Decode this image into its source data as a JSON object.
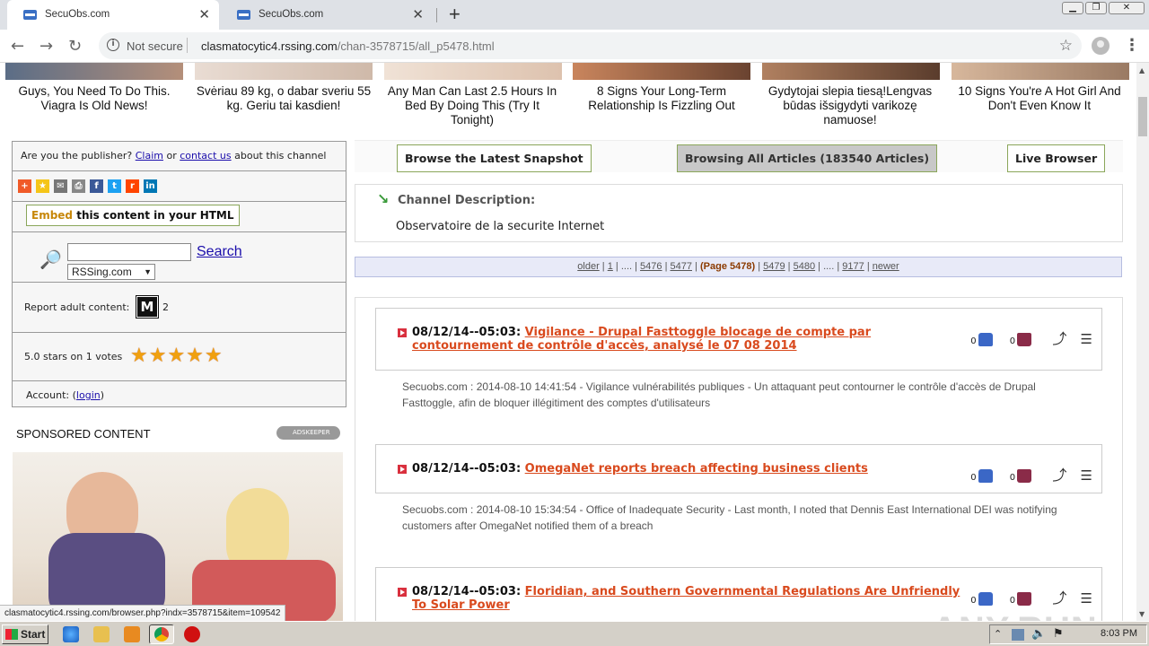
{
  "browser": {
    "tabs": [
      {
        "title": "SecuObs.com",
        "active": true
      },
      {
        "title": "SecuObs.com",
        "active": false
      }
    ],
    "not_secure": "Not secure",
    "url_host": "clasmatocytic4.rssing.com",
    "url_path": "/chan-3578715/all_p5478.html"
  },
  "ads": [
    "Guys, You Need To Do This. Viagra Is Old News!",
    "Svėriau 89 kg, o dabar sveriu 55 kg. Geriu tai kasdien!",
    "Any Man Can Last 2.5 Hours In Bed By Doing This (Try It Tonight)",
    "8 Signs Your Long-Term Relationship Is Fizzling Out",
    "Gydytojai slepia tiesą!Lengvas būdas išsigydyti varikozę namuose!",
    "10 Signs You're A Hot Girl And Don't Even Know It"
  ],
  "sidebar": {
    "publisher_text_1": "Are you the publisher?",
    "claim_link": "Claim",
    "or_text": "or",
    "contact_link": "contact us",
    "publisher_text_2": "about this channel",
    "embed_word": "Embed",
    "embed_rest": " this content in your HTML",
    "search_button": "Search",
    "search_select": "RSSing.com",
    "report_label": "Report adult content:",
    "report_icon": "M",
    "report_count": "2",
    "stars_label": "5.0 stars on 1 votes",
    "account_label": "Account: (",
    "login_link": "login",
    "account_close": ")",
    "sponsored": "SPONSORED CONTENT",
    "adskeeper": "ADSKEEPER"
  },
  "main": {
    "btn_latest": "Browse the Latest Snapshot",
    "btn_all": "Browsing All Articles (183540 Articles)",
    "btn_live": "Live Browser",
    "channel_desc_label": "Channel Description:",
    "channel_desc": "Observatoire de la securite Internet",
    "pager": {
      "older": "older",
      "p1": "1",
      "dots": "....",
      "p5476": "5476",
      "p5477": "5477",
      "current": "(Page 5478)",
      "p5479": "5479",
      "p5480": "5480",
      "p9177": "9177",
      "newer": "newer"
    }
  },
  "articles": [
    {
      "date": "08/12/14--05:03:",
      "title": "Vigilance - Drupal Fasttoggle blocage de compte par contournement de contrôle d'accès, analysé le 07 08 2014",
      "up": "0",
      "down": "0",
      "desc": "Secuobs.com : 2014-08-10 14:41:54 - Vigilance vulnérabilités publiques - Un attaquant peut contourner le contrôle d'accès de Drupal Fasttoggle, afin de bloquer illégitiment des comptes d'utilisateurs"
    },
    {
      "date": "08/12/14--05:03:",
      "title": "OmegaNet reports breach affecting business clients",
      "up": "0",
      "down": "0",
      "desc": "Secuobs.com : 2014-08-10 15:34:54 - Office of Inadequate Security - Last month, I noted that Dennis East International DEI was notifying customers after OmegaNet notified them of a breach"
    },
    {
      "date": "08/12/14--05:03:",
      "title": "Floridian, and Southern Governmental Regulations Are Unfriendly To Solar Power",
      "up": "0",
      "down": "0",
      "desc": ""
    }
  ],
  "status_url": "clasmatocytic4.rssing.com/browser.php?indx=3578715&item=109542",
  "taskbar": {
    "start": "Start",
    "time": "8:03 PM"
  },
  "watermark": "ANY.RUN",
  "colors": {
    "accent_link": "#1a0dab",
    "article_title": "#d94a1e",
    "button_border": "#8aa65a",
    "pager_bg": "#e8eaf8"
  }
}
